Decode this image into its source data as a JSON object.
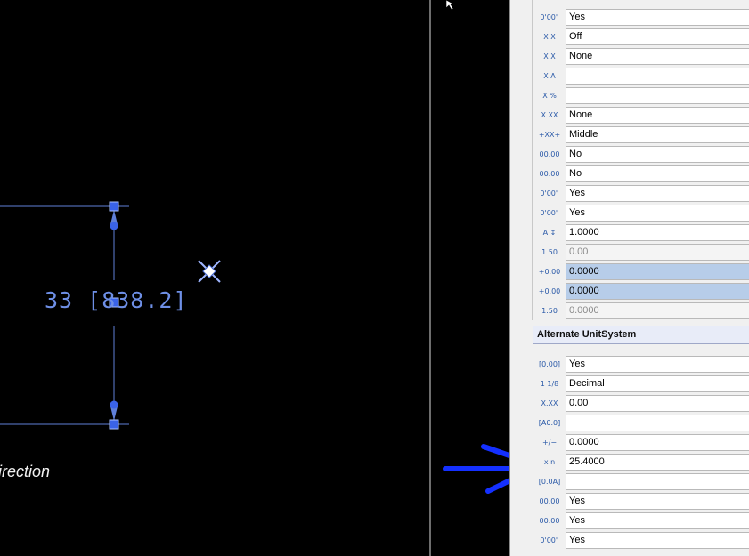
{
  "canvas": {
    "dimension_text": "33 [838.2]",
    "direction_text": "irection"
  },
  "panel": {
    "section_title": "Alternate UnitSystem",
    "rows_top": [
      {
        "icon": "0'00\"",
        "value": "Yes"
      },
      {
        "icon": "X X",
        "value": "Off"
      },
      {
        "icon": "X X",
        "value": "None"
      },
      {
        "icon": "X A",
        "value": ""
      },
      {
        "icon": "X %",
        "value": ""
      },
      {
        "icon": "X.XX",
        "value": "None"
      },
      {
        "icon": "+XX+",
        "value": "Middle"
      },
      {
        "icon": "00.00",
        "value": "No"
      },
      {
        "icon": "00.00",
        "value": "No"
      },
      {
        "icon": "0'00\"",
        "value": "Yes"
      },
      {
        "icon": "0'00\"",
        "value": "Yes"
      },
      {
        "icon": "A ↕",
        "value": "1.0000"
      },
      {
        "icon": "1.50",
        "value": "0.00"
      },
      {
        "icon": "+0.00",
        "value": "0.0000"
      },
      {
        "icon": "+0.00",
        "value": "0.0000"
      },
      {
        "icon": "1.50",
        "value": "0.0000"
      }
    ],
    "rows_alt": [
      {
        "icon": "[0.00]",
        "value": "Yes"
      },
      {
        "icon": "1 1/8",
        "value": "Decimal"
      },
      {
        "icon": "X.XX",
        "value": "0.00"
      },
      {
        "icon": "[A0.0]",
        "value": ""
      },
      {
        "icon": "+/−",
        "value": "0.0000"
      },
      {
        "icon": "x n",
        "value": "25.4000"
      },
      {
        "icon": "[0.0A]",
        "value": ""
      },
      {
        "icon": "00.00",
        "value": "Yes"
      },
      {
        "icon": "00.00",
        "value": "Yes"
      },
      {
        "icon": "0'00\"",
        "value": "Yes"
      }
    ]
  }
}
